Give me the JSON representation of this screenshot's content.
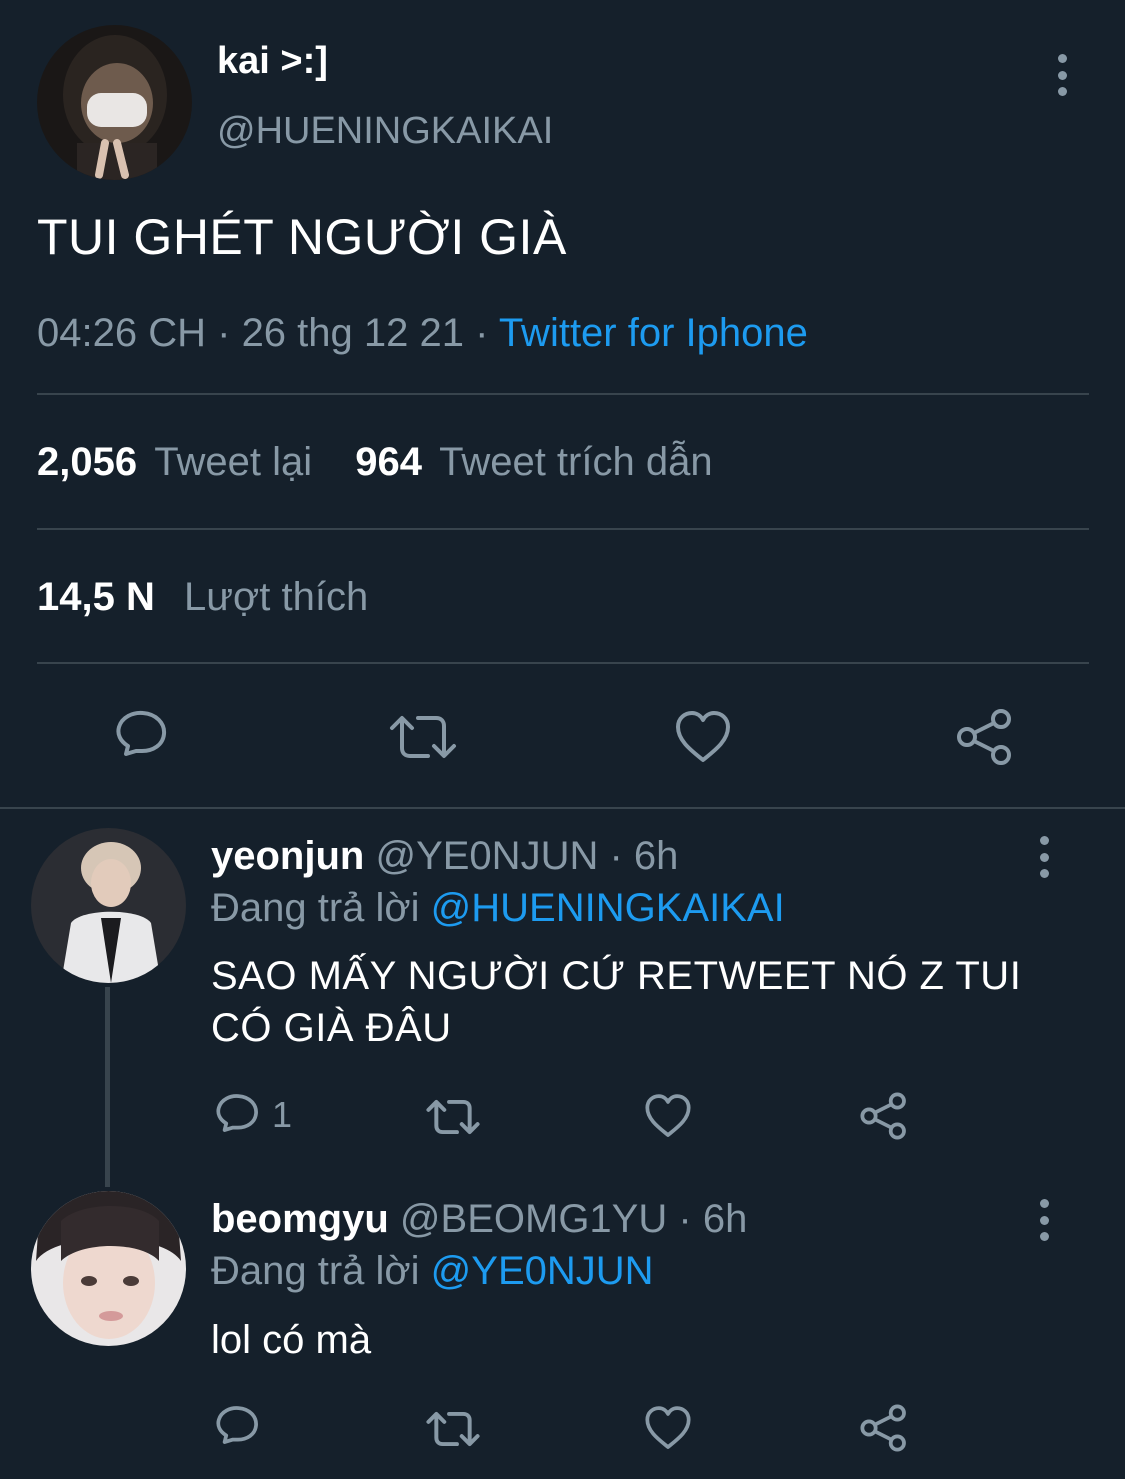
{
  "main_tweet": {
    "display_name": "kai >:]",
    "handle": "@HUENINGKAIKAI",
    "text": "TUI GHÉT NGƯỜI GIÀ",
    "time": "04:26 CH",
    "sep1": "·",
    "date": "26 thg 12 21",
    "sep2": "·",
    "source": "Twitter for Iphone",
    "retweets_count": "2,056",
    "retweets_label": "Tweet lại",
    "quotes_count": "964",
    "quotes_label": "Tweet trích dẫn",
    "likes_count": "14,5 N",
    "likes_label": "Lượt thích",
    "actions": [
      "reply-icon",
      "retweet-icon",
      "like-icon",
      "share-icon"
    ]
  },
  "replies": [
    {
      "display_name": "yeonjun",
      "handle": "@YE0NJUN",
      "dot": "·",
      "time": "6h",
      "replying_label": "Đang trả lời",
      "replying_to": "@HUENINGKAIKAI",
      "text_line1": "SAO MẤY NGƯỜI CỨ RETWEET NÓ Z TUI",
      "text_line2": "CÓ GIÀ ĐÂU",
      "reply_count": "1"
    },
    {
      "display_name": "beomgyu",
      "handle": "@BEOMG1YU",
      "dot": "·",
      "time": "6h",
      "replying_label": "Đang trả lời",
      "replying_to": "@YE0NJUN",
      "text_line1": "lol có mà",
      "reply_count": ""
    }
  ],
  "colors": {
    "background": "#15202b",
    "accent": "#1d9bf0",
    "muted": "#8899a6",
    "divider": "#38444d"
  }
}
